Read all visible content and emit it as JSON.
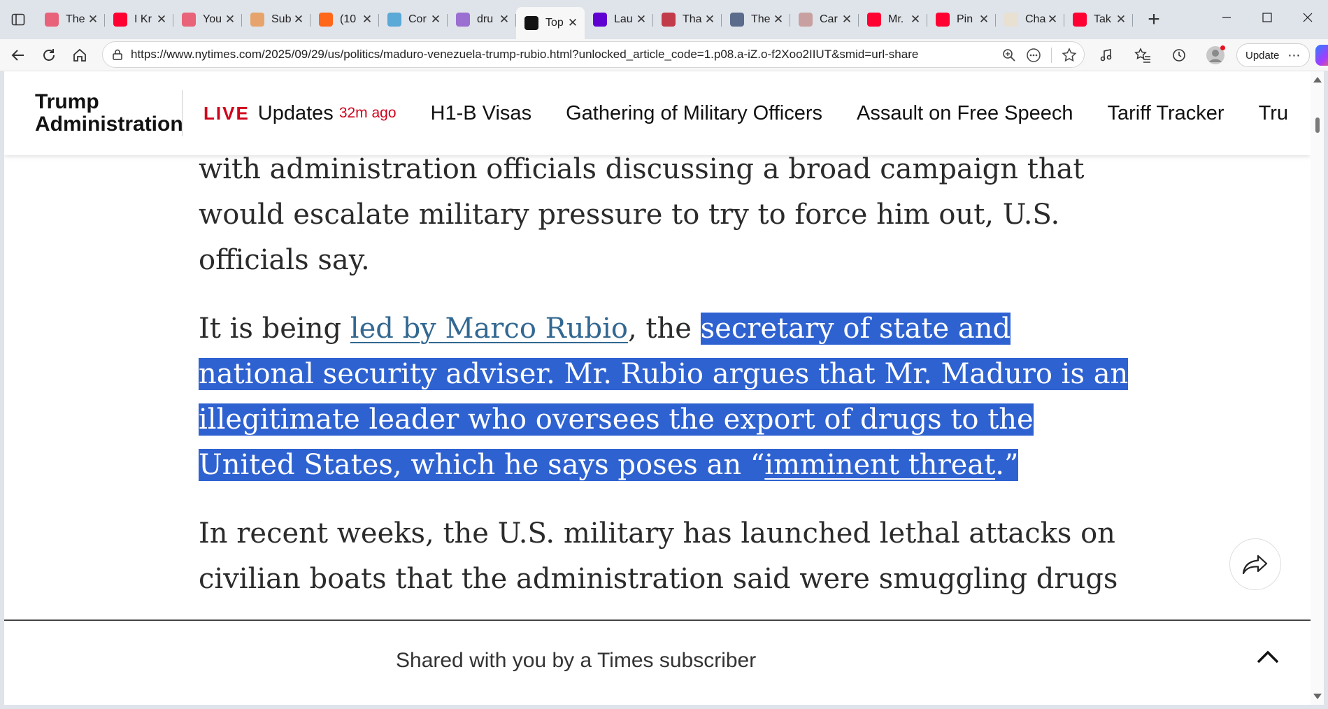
{
  "browser": {
    "tabs": [
      {
        "title": "The",
        "favicon": "youtube-pink-icon",
        "color": "#e8637a"
      },
      {
        "title": "I Kr",
        "favicon": "youtube-icon",
        "color": "#ff0033"
      },
      {
        "title": "You",
        "favicon": "youtube-pink-icon",
        "color": "#e8637a"
      },
      {
        "title": "Sub",
        "favicon": "substack-beige-icon",
        "color": "#e6a46c"
      },
      {
        "title": "(10",
        "favicon": "substack-icon",
        "color": "#ff6719"
      },
      {
        "title": "Cor",
        "favicon": "chatgpt-icon",
        "color": "#5aa9d6"
      },
      {
        "title": "dru",
        "favicon": "yahoo-purple-icon",
        "color": "#9b6fd1"
      },
      {
        "title": "Top",
        "favicon": "nyt-icon",
        "color": "#121212",
        "active": true
      },
      {
        "title": "Lau",
        "favicon": "yahoo-icon",
        "color": "#6001d2"
      },
      {
        "title": "Tha",
        "favicon": "flag-icon",
        "color": "#c23b4a"
      },
      {
        "title": "The",
        "favicon": "gp-icon",
        "color": "#5a6b8c"
      },
      {
        "title": "Car",
        "favicon": "plane-icon",
        "color": "#c9a0a0"
      },
      {
        "title": "Mr.",
        "favicon": "youtube-icon",
        "color": "#ff0033"
      },
      {
        "title": "Pin",
        "favicon": "youtube-icon",
        "color": "#ff0033"
      },
      {
        "title": "Cha",
        "favicon": "notion-icon",
        "color": "#e8e0d0"
      },
      {
        "title": "Tak",
        "favicon": "youtube-icon",
        "color": "#ff0033"
      }
    ],
    "url": "https://www.nytimes.com/2025/09/29/us/politics/maduro-venezuela-trump-rubio.html?unlocked_article_code=1.p08.a-iZ.o-f2Xoo2IIUT&smid=url-share",
    "update_label": "Update"
  },
  "header": {
    "section_title": "Trump Administration",
    "live_label": "LIVE",
    "live_text": "Updates",
    "live_ago": "32m ago",
    "nav": [
      "H1-B Visas",
      "Gathering of Military Officers",
      "Assault on Free Speech",
      "Tariff Tracker",
      "Tru"
    ]
  },
  "article": {
    "p1": "with administration officials discussing a broad campaign that would escalate military pressure to try to force him out, U.S. officials say.",
    "p2_start": "It is being ",
    "p2_link": "led by Marco Rubio",
    "p2_mid": ", the ",
    "p2_sel1": "secretary of state and national security adviser. Mr. Rubio argues that Mr. Maduro is an illegitimate leader who oversees the export of drugs to the United States, which he says poses an “",
    "p2_sel_link": "imminent threat",
    "p2_sel2": ".”",
    "p3": "In recent weeks, the U.S. military has launched lethal attacks on civilian boats that the administration said were smuggling drugs"
  },
  "shared_bar": {
    "text": "Shared with you by a Times subscriber"
  }
}
